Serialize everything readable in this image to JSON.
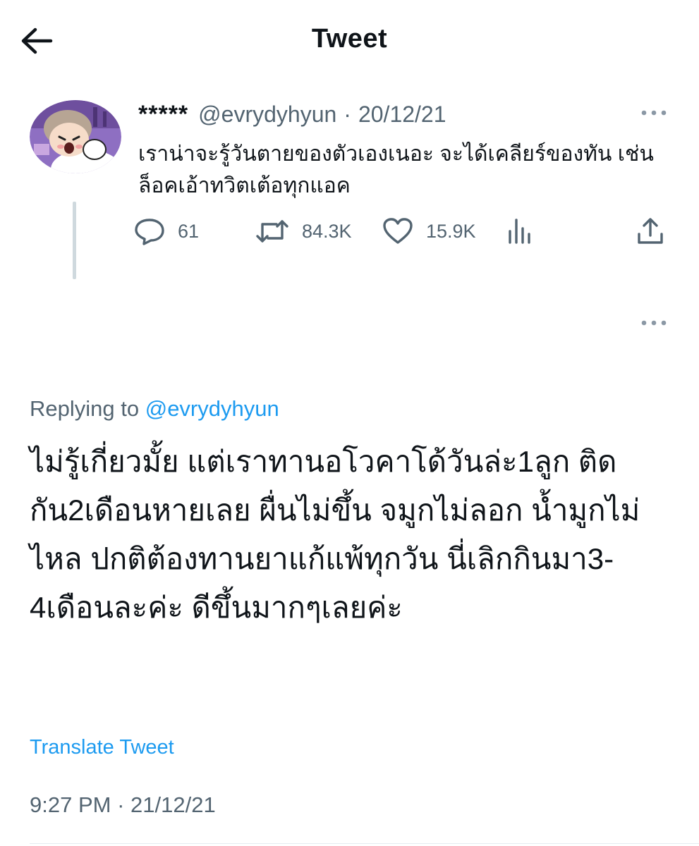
{
  "header": {
    "title": "Tweet",
    "back_icon": "arrow-left-icon"
  },
  "parent_tweet": {
    "display_name": "*****",
    "handle": "@evrydyhyun",
    "separator": "·",
    "date": "20/12/21",
    "text": "เราน่าจะรู้วันตายของตัวเองเนอะ จะได้เคลียร์ของทัน เช่น ล็อคเอ้าทวิตเต้อทุกแอค",
    "actions": {
      "reply_count": "61",
      "retweet_count": "84.3K",
      "like_count": "15.9K"
    },
    "icons": {
      "reply": "reply-icon",
      "retweet": "retweet-icon",
      "like": "heart-icon",
      "analytics": "analytics-icon",
      "share": "share-icon",
      "more": "more-icon"
    }
  },
  "reply": {
    "replying_prefix": "Replying to",
    "replying_handle": "@evrydyhyun",
    "text": "ไม่รู้เกี่ยวมั้ย แต่เราทานอโวคาโด้วันล่ะ1ลูก ติดกัน2เดือนหายเลย ผื่นไม่ขึ้น จมูกไม่ลอก น้ำมูกไม่ไหล ปกติต้องทานยาแก้แพ้ทุกวัน นี่เลิกกินมา3-4เดือนละค่ะ ดีขึ้นมากๆเลยค่ะ",
    "translate_label": "Translate Tweet",
    "time": "9:27 PM",
    "separator": "·",
    "date": "21/12/21"
  },
  "colors": {
    "text_primary": "#0f1419",
    "text_secondary": "#536471",
    "accent": "#1d9bf0",
    "thread_line": "#cfd9de"
  }
}
